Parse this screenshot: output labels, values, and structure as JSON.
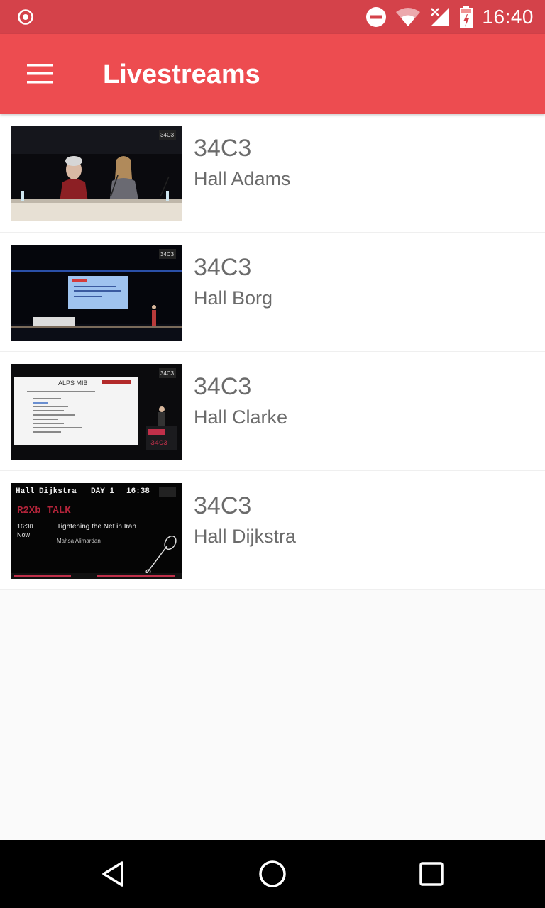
{
  "status_bar": {
    "time": "16:40",
    "icons": [
      "record-icon",
      "do-not-disturb-icon",
      "wifi-icon",
      "signal-no-service-icon",
      "battery-charging-icon"
    ]
  },
  "app_bar": {
    "title": "Livestreams",
    "menu_icon": "hamburger-menu-icon"
  },
  "streams": [
    {
      "title": "34C3",
      "subtitle": "Hall Adams"
    },
    {
      "title": "34C3",
      "subtitle": "Hall Borg"
    },
    {
      "title": "34C3",
      "subtitle": "Hall Clarke"
    },
    {
      "title": "34C3",
      "subtitle": "Hall Dijkstra"
    }
  ],
  "thumb_text": {
    "slide_title": "ALPS MIB",
    "banner_hall": "Hall Dijkstra",
    "banner_day": "DAY 1",
    "banner_time": "16:38",
    "talk_label": "R2Xb TALK",
    "talk_time": "16:30",
    "talk_now": "Now",
    "talk_title": "Tightening the Net in Iran",
    "talk_speaker": "Mahsa Alimardani"
  },
  "nav_bar": {
    "icons": [
      "back-icon",
      "home-icon",
      "recents-icon"
    ]
  },
  "colors": {
    "status_bar": "#d4424a",
    "app_bar": "#ed4c50",
    "text_secondary": "#6b6b6b",
    "background": "#fafafa"
  }
}
